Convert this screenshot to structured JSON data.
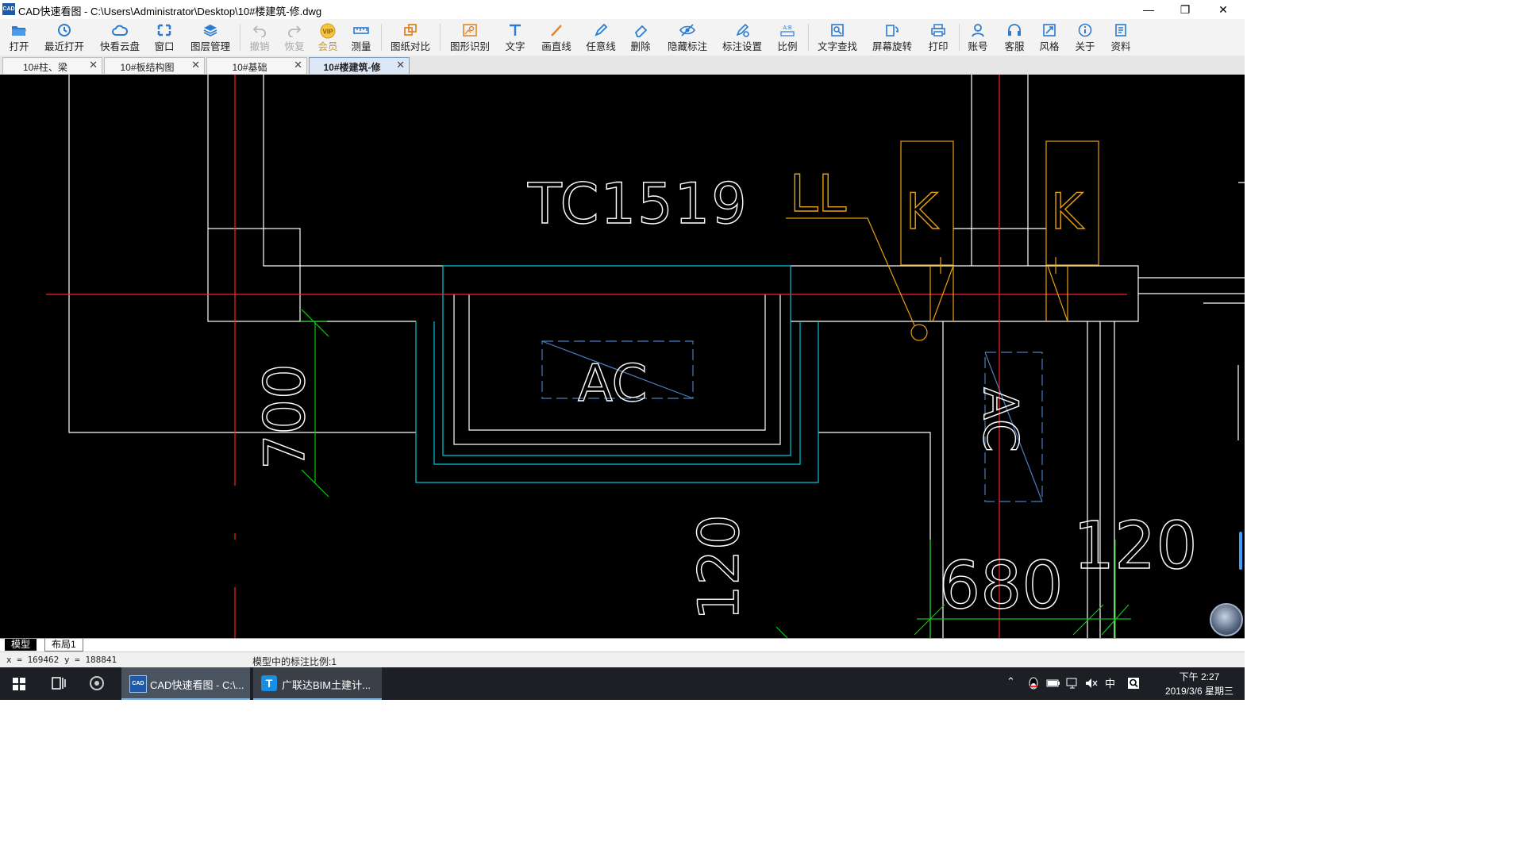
{
  "window": {
    "title": "CAD快速看图 - C:\\Users\\Administrator\\Desktop\\10#楼建筑-修.dwg",
    "app_icon_text": "CAD",
    "buttons": [
      "minimize",
      "restore",
      "close"
    ]
  },
  "toolbar": [
    {
      "label": "打开",
      "icon": "folder-icon",
      "state": "normal"
    },
    {
      "label": "最近打开",
      "icon": "recent-icon",
      "state": "normal"
    },
    {
      "label": "快看云盘",
      "icon": "cloud-icon",
      "state": "normal"
    },
    {
      "label": "窗口",
      "icon": "window-icon",
      "state": "normal"
    },
    {
      "label": "图层管理",
      "icon": "layers-icon",
      "state": "normal"
    },
    {
      "label": "撤销",
      "icon": "undo-icon",
      "state": "disabled"
    },
    {
      "label": "恢复",
      "icon": "redo-icon",
      "state": "disabled"
    },
    {
      "label": "会员",
      "icon": "vip-icon",
      "state": "vip"
    },
    {
      "label": "测量",
      "icon": "ruler-icon",
      "state": "normal"
    },
    {
      "label": "图纸对比",
      "icon": "compare-icon",
      "state": "normal"
    },
    {
      "label": "图形识别",
      "icon": "shape-recognition-icon",
      "state": "normal"
    },
    {
      "label": "文字",
      "icon": "text-icon",
      "state": "normal"
    },
    {
      "label": "画直线",
      "icon": "line-icon",
      "state": "normal"
    },
    {
      "label": "任意线",
      "icon": "pen-icon",
      "state": "normal"
    },
    {
      "label": "删除",
      "icon": "eraser-icon",
      "state": "normal"
    },
    {
      "label": "隐藏标注",
      "icon": "eye-hide-icon",
      "state": "normal"
    },
    {
      "label": "标注设置",
      "icon": "annotation-settings-icon",
      "state": "normal"
    },
    {
      "label": "比例",
      "icon": "scale-icon",
      "state": "normal"
    },
    {
      "label": "文字查找",
      "icon": "find-text-icon",
      "state": "normal"
    },
    {
      "label": "屏幕旋转",
      "icon": "rotate-icon",
      "state": "normal"
    },
    {
      "label": "打印",
      "icon": "printer-icon",
      "state": "normal"
    },
    {
      "label": "账号",
      "icon": "user-icon",
      "state": "normal"
    },
    {
      "label": "客服",
      "icon": "headset-icon",
      "state": "normal"
    },
    {
      "label": "风格",
      "icon": "style-icon",
      "state": "normal"
    },
    {
      "label": "关于",
      "icon": "info-icon",
      "state": "normal"
    },
    {
      "label": "资料",
      "icon": "document-icon",
      "state": "normal"
    }
  ],
  "tabs": [
    {
      "label": "10#柱、梁",
      "active": false
    },
    {
      "label": "10#板结构图",
      "active": false
    },
    {
      "label": "10#基础",
      "active": false
    },
    {
      "label": "10#楼建筑-修",
      "active": true
    }
  ],
  "drawing": {
    "texts": [
      "TC1519",
      "LL",
      "K",
      "K",
      "AC",
      "700",
      "120",
      "AC",
      "680",
      "120"
    ],
    "colors": {
      "wall": "#ffffff",
      "axis": "#ff2020",
      "window": "#00c8d8",
      "dimension": "#12c412",
      "annotation": "#e8a010",
      "ac_box": "#4a7fc0"
    }
  },
  "layout_tabs": [
    {
      "label": "模型",
      "active": true
    },
    {
      "label": "布局1",
      "active": false
    }
  ],
  "status": {
    "coords": "x = 169462 y = 188841",
    "scale_text": "模型中的标注比例:1"
  },
  "taskbar": {
    "apps": [
      {
        "label": "CAD快速看图 - C:\\...",
        "active": true
      },
      {
        "label": "广联达BIM土建计...",
        "active": false
      }
    ],
    "ime": "中",
    "time": "下午 2:27",
    "date": "2019/3/6 星期三"
  }
}
